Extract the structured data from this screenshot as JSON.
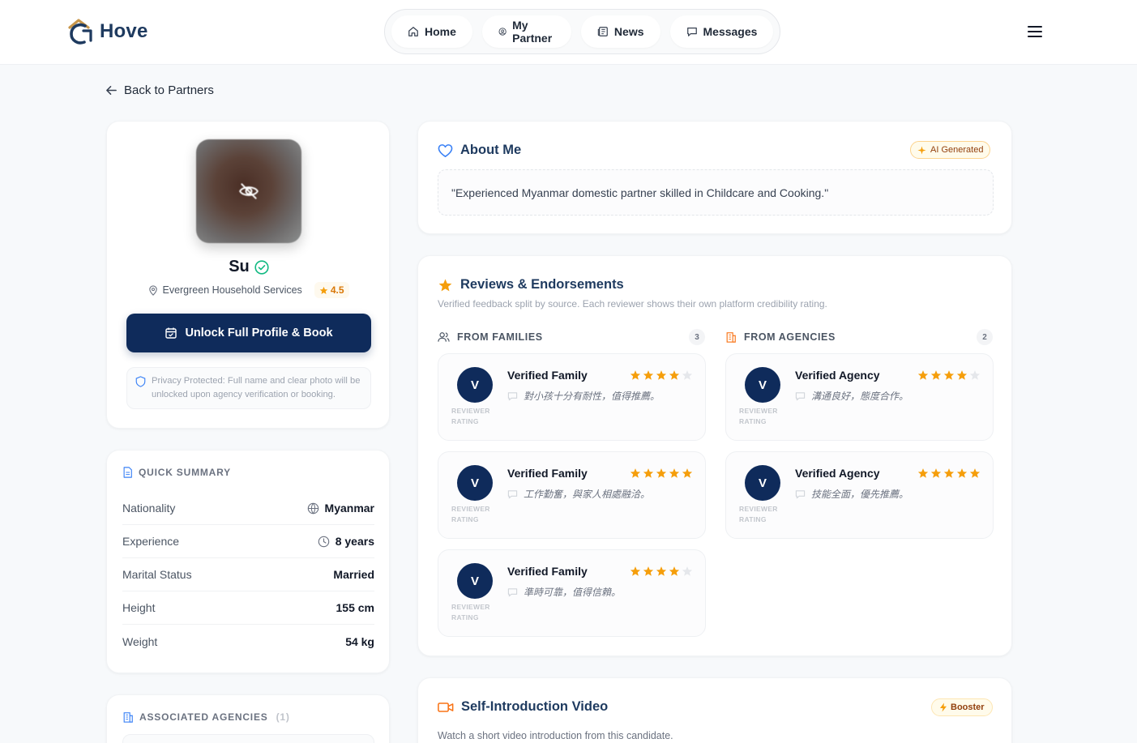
{
  "header": {
    "logo_text": "Hove",
    "nav": [
      {
        "label": "Home",
        "icon": "home-icon"
      },
      {
        "label": "My Partner",
        "icon": "user-circle-icon"
      },
      {
        "label": "News",
        "icon": "newspaper-icon"
      },
      {
        "label": "Messages",
        "icon": "message-icon"
      }
    ],
    "menu_icon": "hamburger-icon"
  },
  "back_link": "Back to Partners",
  "profile": {
    "name": "Su",
    "agency": "Evergreen Household Services",
    "rating": "4.5",
    "unlock_button": "Unlock Full Profile & Book",
    "privacy_note": "Privacy Protected: Full name and clear photo will be unlocked upon agency verification or booking."
  },
  "summary": {
    "title": "QUICK SUMMARY",
    "rows": [
      {
        "label": "Nationality",
        "value": "Myanmar",
        "icon": "globe-icon"
      },
      {
        "label": "Experience",
        "value": "8 years",
        "icon": "clock-icon"
      },
      {
        "label": "Marital Status",
        "value": "Married",
        "icon": ""
      },
      {
        "label": "Height",
        "value": "155 cm",
        "icon": ""
      },
      {
        "label": "Weight",
        "value": "54 kg",
        "icon": ""
      }
    ]
  },
  "associated": {
    "title": "ASSOCIATED AGENCIES",
    "count": "(1)"
  },
  "about": {
    "title": "About Me",
    "badge": "AI Generated",
    "text": "\"Experienced Myanmar domestic partner skilled in Childcare and Cooking.\""
  },
  "reviews": {
    "title": "Reviews & Endorsements",
    "subtitle": "Verified feedback split by source. Each reviewer shows their own platform credibility rating.",
    "families": {
      "label": "FROM FAMILIES",
      "count": "3",
      "items": [
        {
          "initial": "V",
          "name": "Verified Family",
          "stars": 4,
          "text": "對小孩十分有耐性，值得推薦。",
          "rating_label": "REVIEWER RATING"
        },
        {
          "initial": "V",
          "name": "Verified Family",
          "stars": 5,
          "text": "工作勤奮，與家人相處融洽。",
          "rating_label": "REVIEWER RATING"
        },
        {
          "initial": "V",
          "name": "Verified Family",
          "stars": 4,
          "text": "準時可靠，值得信賴。",
          "rating_label": "REVIEWER RATING"
        }
      ]
    },
    "agencies": {
      "label": "FROM AGENCIES",
      "count": "2",
      "items": [
        {
          "initial": "V",
          "name": "Verified Agency",
          "stars": 4,
          "text": "溝通良好，態度合作。",
          "rating_label": "REVIEWER RATING"
        },
        {
          "initial": "V",
          "name": "Verified Agency",
          "stars": 5,
          "text": "技能全面，優先推薦。",
          "rating_label": "REVIEWER RATING"
        }
      ]
    }
  },
  "video": {
    "title": "Self-Introduction Video",
    "badge": "Booster",
    "subtitle": "Watch a short video introduction from this candidate."
  },
  "colors": {
    "navy": "#0f2b5b",
    "star": "#f59e0b",
    "verified": "#10b981",
    "accent_orange": "#f97316"
  }
}
